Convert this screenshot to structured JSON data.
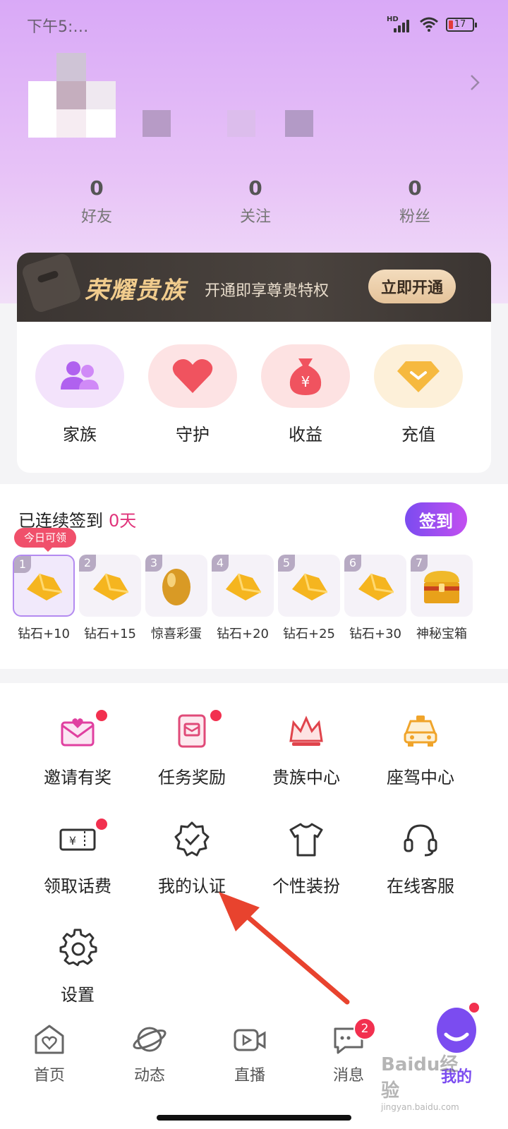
{
  "status_bar": {
    "time": "下午5:…",
    "network": "HD",
    "battery": "17"
  },
  "stats": [
    {
      "value": "0",
      "label": "好友"
    },
    {
      "value": "0",
      "label": "关注"
    },
    {
      "value": "0",
      "label": "粉丝"
    }
  ],
  "vip": {
    "title": "荣耀贵族",
    "subtitle": "开通即享尊贵特权",
    "button": "立即开通"
  },
  "quick_actions": [
    {
      "label": "家族",
      "icon": "family-icon"
    },
    {
      "label": "守护",
      "icon": "heart-icon"
    },
    {
      "label": "收益",
      "icon": "money-bag-icon"
    },
    {
      "label": "充值",
      "icon": "diamond-icon"
    }
  ],
  "signin": {
    "prefix": "已连续签到",
    "days": "0天",
    "button": "签到",
    "today_tag": "今日可领",
    "rewards": [
      {
        "day": "1",
        "label": "钻石+10",
        "icon": "diamond-reward-icon"
      },
      {
        "day": "2",
        "label": "钻石+15",
        "icon": "diamond-reward-icon"
      },
      {
        "day": "3",
        "label": "惊喜彩蛋",
        "icon": "golden-egg-icon"
      },
      {
        "day": "4",
        "label": "钻石+20",
        "icon": "diamond-reward-icon"
      },
      {
        "day": "5",
        "label": "钻石+25",
        "icon": "diamond-reward-icon"
      },
      {
        "day": "6",
        "label": "钻石+30",
        "icon": "diamond-reward-icon"
      },
      {
        "day": "7",
        "label": "神秘宝箱",
        "icon": "treasure-chest-icon"
      }
    ]
  },
  "menu": [
    {
      "label": "邀请有奖",
      "icon": "envelope-heart-icon",
      "dot": true
    },
    {
      "label": "任务奖励",
      "icon": "task-icon",
      "dot": true
    },
    {
      "label": "贵族中心",
      "icon": "crown-icon",
      "dot": false
    },
    {
      "label": "座驾中心",
      "icon": "car-icon",
      "dot": false
    },
    {
      "label": "领取话费",
      "icon": "ticket-icon",
      "dot": true
    },
    {
      "label": "我的认证",
      "icon": "verified-badge-icon",
      "dot": false
    },
    {
      "label": "个性装扮",
      "icon": "tshirt-icon",
      "dot": false
    },
    {
      "label": "在线客服",
      "icon": "headset-icon",
      "dot": false
    },
    {
      "label": "设置",
      "icon": "gear-icon",
      "dot": false
    }
  ],
  "tabs": [
    {
      "label": "首页",
      "icon": "home-icon"
    },
    {
      "label": "动态",
      "icon": "planet-icon"
    },
    {
      "label": "直播",
      "icon": "video-icon"
    },
    {
      "label": "消息",
      "icon": "chat-icon",
      "badge": "2"
    },
    {
      "label": "我的",
      "icon": "mascot-icon"
    }
  ],
  "watermark": {
    "text": "Baidu经验",
    "sub": "jingyan.baidu.com"
  },
  "colors": {
    "accent_purple": "#7b4cf0",
    "pink": "#e0337a",
    "gold": "#f1cc8d",
    "red_dot": "#f2304f"
  }
}
